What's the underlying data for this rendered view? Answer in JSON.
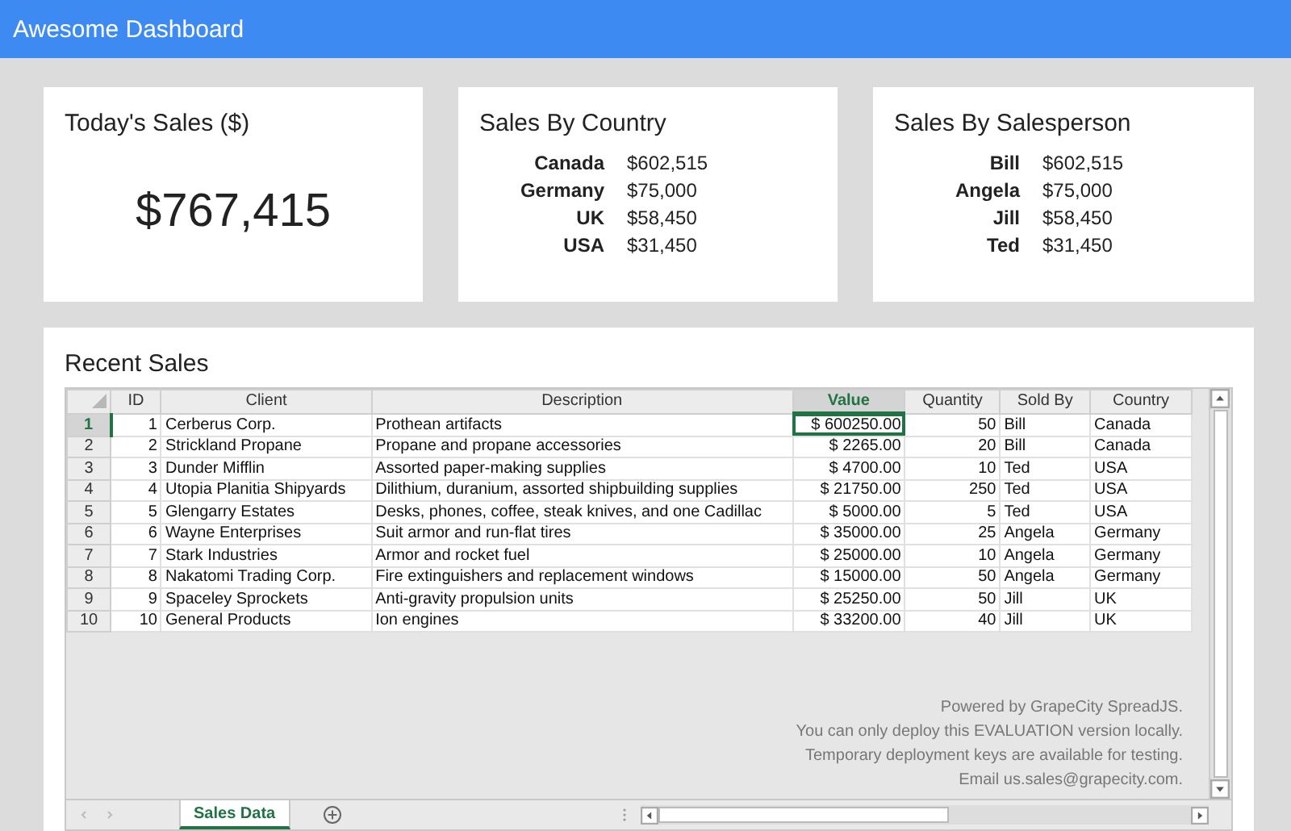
{
  "header": {
    "title": "Awesome Dashboard"
  },
  "todays_sales": {
    "title": "Today's Sales ($)",
    "value": "$767,415"
  },
  "sales_by_country": {
    "title": "Sales By Country",
    "rows": [
      {
        "label": "Canada",
        "value": "$602,515"
      },
      {
        "label": "Germany",
        "value": "$75,000"
      },
      {
        "label": "UK",
        "value": "$58,450"
      },
      {
        "label": "USA",
        "value": "$31,450"
      }
    ]
  },
  "sales_by_salesperson": {
    "title": "Sales By Salesperson",
    "rows": [
      {
        "label": "Bill",
        "value": "$602,515"
      },
      {
        "label": "Angela",
        "value": "$75,000"
      },
      {
        "label": "Jill",
        "value": "$58,450"
      },
      {
        "label": "Ted",
        "value": "$31,450"
      }
    ]
  },
  "recent_sales": {
    "title": "Recent Sales",
    "columns": [
      {
        "label": "ID",
        "kind": "number",
        "selected": false
      },
      {
        "label": "Client",
        "kind": "text",
        "selected": false
      },
      {
        "label": "Description",
        "kind": "text",
        "selected": false
      },
      {
        "label": "Value",
        "kind": "number",
        "selected": true
      },
      {
        "label": "Quantity",
        "kind": "number",
        "selected": false
      },
      {
        "label": "Sold By",
        "kind": "text",
        "selected": false
      },
      {
        "label": "Country",
        "kind": "text",
        "selected": false
      }
    ],
    "rows": [
      {
        "number": "1",
        "selected": true,
        "cells": [
          "1",
          "Cerberus Corp.",
          "Prothean artifacts",
          "$ 600250.00",
          "50",
          "Bill",
          "Canada"
        ]
      },
      {
        "number": "2",
        "selected": false,
        "cells": [
          "2",
          "Strickland Propane",
          "Propane and propane accessories",
          "$ 2265.00",
          "20",
          "Bill",
          "Canada"
        ]
      },
      {
        "number": "3",
        "selected": false,
        "cells": [
          "3",
          "Dunder Mifflin",
          "Assorted paper-making supplies",
          "$ 4700.00",
          "10",
          "Ted",
          "USA"
        ]
      },
      {
        "number": "4",
        "selected": false,
        "cells": [
          "4",
          "Utopia Planitia Shipyards",
          "Dilithium, duranium, assorted shipbuilding supplies",
          "$ 21750.00",
          "250",
          "Ted",
          "USA"
        ]
      },
      {
        "number": "5",
        "selected": false,
        "cells": [
          "5",
          "Glengarry Estates",
          "Desks, phones, coffee, steak knives, and one Cadillac",
          "$ 5000.00",
          "5",
          "Ted",
          "USA"
        ]
      },
      {
        "number": "6",
        "selected": false,
        "cells": [
          "6",
          "Wayne Enterprises",
          "Suit armor and run-flat tires",
          "$ 35000.00",
          "25",
          "Angela",
          "Germany"
        ]
      },
      {
        "number": "7",
        "selected": false,
        "cells": [
          "7",
          "Stark Industries",
          "Armor and rocket fuel",
          "$ 25000.00",
          "10",
          "Angela",
          "Germany"
        ]
      },
      {
        "number": "8",
        "selected": false,
        "cells": [
          "8",
          "Nakatomi Trading Corp.",
          "Fire extinguishers and replacement windows",
          "$ 15000.00",
          "50",
          "Angela",
          "Germany"
        ]
      },
      {
        "number": "9",
        "selected": false,
        "cells": [
          "9",
          "Spaceley Sprockets",
          "Anti-gravity propulsion units",
          "$ 25250.00",
          "50",
          "Jill",
          "UK"
        ]
      },
      {
        "number": "10",
        "selected": false,
        "cells": [
          "10",
          "General Products",
          "Ion engines",
          "$ 33200.00",
          "40",
          "Jill",
          "UK"
        ]
      }
    ],
    "notice": [
      "Powered by GrapeCity SpreadJS.",
      "You can only deploy this EVALUATION version locally.",
      "Temporary deployment keys are available for testing.",
      "Email us.sales@grapecity.com."
    ],
    "sheet_tabs": [
      {
        "label": "Sales Data",
        "selected": true
      }
    ]
  }
}
